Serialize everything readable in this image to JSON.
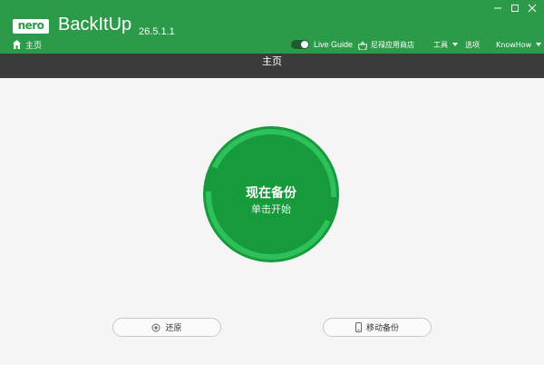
{
  "app": {
    "logo_text": "nero",
    "name": "BackItUp",
    "version": "26.5.1.1",
    "brand_color": "#2b9a49"
  },
  "breadcrumb": {
    "home_label": "主页",
    "icon": "home-icon"
  },
  "header_tools": {
    "live_guide_label": "Live Guide",
    "live_guide_on": true,
    "store_label": "尼禄应用商店",
    "tools_label": "工具",
    "options_label": "选项",
    "knowhow_label": "KnowHow"
  },
  "window_controls": [
    "minimize-icon",
    "maximize-icon",
    "close-icon"
  ],
  "page": {
    "title": "主页"
  },
  "backup_button": {
    "main_label": "现在备份",
    "sub_label": "单击开始",
    "color": "#169a3b",
    "ring_color": "#2ec05a"
  },
  "bottom_actions": {
    "restore_label": "还原",
    "mobile_backup_label": "移动备份"
  }
}
